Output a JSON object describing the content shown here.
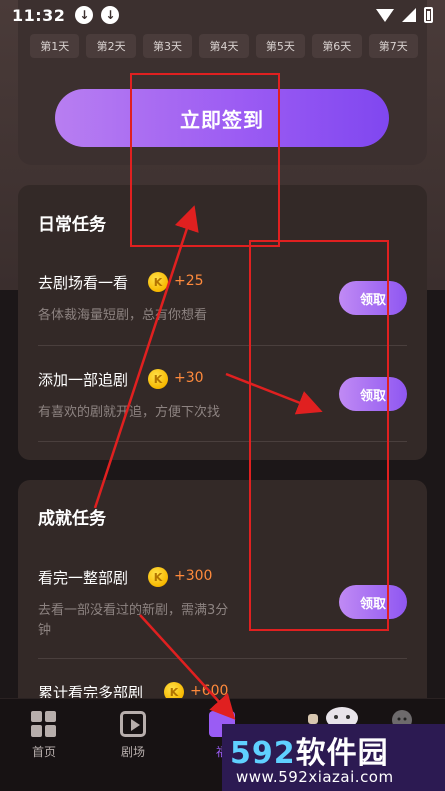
{
  "status_bar": {
    "time": "11:32"
  },
  "signin": {
    "days": [
      "第1天",
      "第2天",
      "第3天",
      "第4天",
      "第5天",
      "第6天",
      "第7天"
    ],
    "button_label": "立即签到"
  },
  "daily_tasks": {
    "title": "日常任务",
    "items": [
      {
        "name": "去剧场看一看",
        "reward": "+25",
        "desc": "各体裁海量短剧，总有你想看",
        "button": "领取"
      },
      {
        "name": "添加一部追剧",
        "reward": "+30",
        "desc": "有喜欢的剧就开追，方便下次找",
        "button": "领取"
      }
    ]
  },
  "achievement_tasks": {
    "title": "成就任务",
    "items": [
      {
        "name": "看完一整部剧",
        "reward": "+300",
        "desc_line1": "去看一部没看过的新剧，需满3分",
        "desc_line2": "钟",
        "button": "领取"
      },
      {
        "name": "累计看完多部剧",
        "reward": "+600"
      }
    ]
  },
  "tabbar": {
    "tabs": [
      {
        "label": "首页"
      },
      {
        "label": "剧场"
      },
      {
        "label": "福"
      }
    ]
  },
  "coin_glyph": "K",
  "watermark": {
    "logo_num": "592",
    "logo_text": "软件园",
    "url": "www.592xiazai.com"
  },
  "colors": {
    "accent": "#9a5cf4",
    "reward": "#ff8a3c",
    "annotation": "#e02020"
  }
}
